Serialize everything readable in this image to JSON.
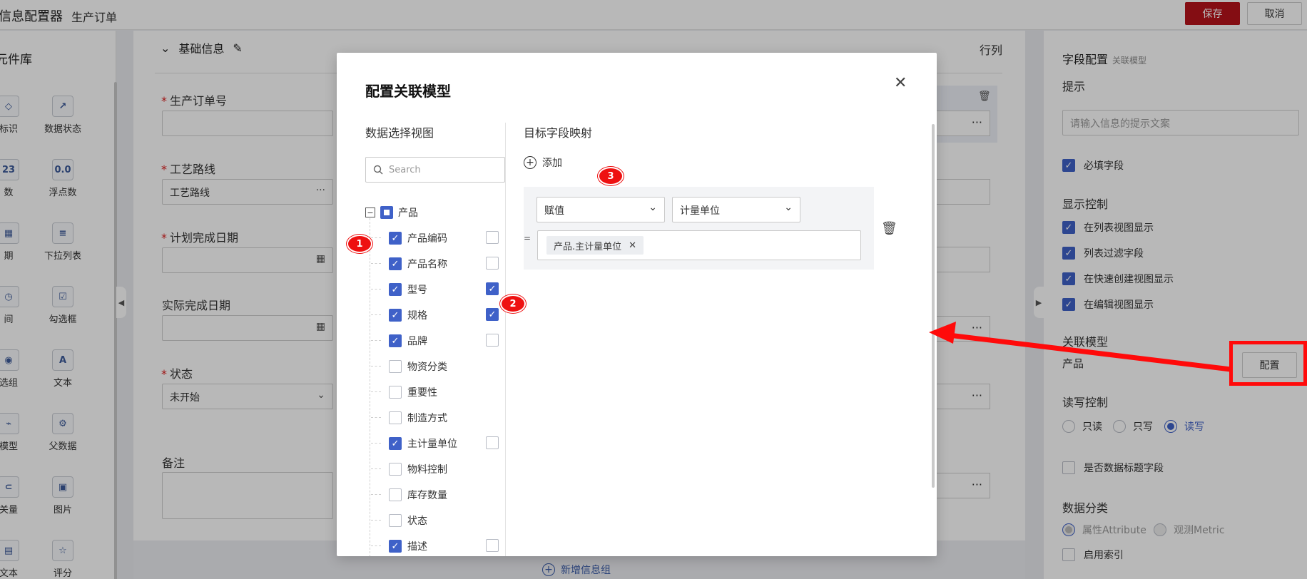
{
  "topbar": {
    "app_title": "信息配置器",
    "doc_title": "生产订单",
    "save_label": "保存",
    "cancel_label": "取消"
  },
  "left_panel": {
    "title": "元件库",
    "items": [
      {
        "label": "标识",
        "icon": "tag-icon"
      },
      {
        "label": "数据状态",
        "icon": "status-line-icon"
      },
      {
        "label": "数",
        "icon": "integer-icon"
      },
      {
        "label": "浮点数",
        "icon": "float-icon"
      },
      {
        "label": "期",
        "icon": "calendar-icon"
      },
      {
        "label": "下拉列表",
        "icon": "dropdown-list-icon"
      },
      {
        "label": "间",
        "icon": "clock-icon"
      },
      {
        "label": "勾选框",
        "icon": "checkbox-icon"
      },
      {
        "label": "选组",
        "icon": "radio-group-icon"
      },
      {
        "label": "文本",
        "icon": "text-icon"
      },
      {
        "label": "模型",
        "icon": "link-model-icon"
      },
      {
        "label": "父数据",
        "icon": "gear-icon"
      },
      {
        "label": "关量",
        "icon": "switch-icon"
      },
      {
        "label": "图片",
        "icon": "image-icon"
      },
      {
        "label": "文本",
        "icon": "long-text-icon"
      },
      {
        "label": "评分",
        "icon": "star-icon"
      }
    ],
    "icon_glyphs": [
      "◇",
      "↗",
      "23",
      "0.0",
      "▦",
      "≡",
      "◷",
      "☑",
      "◉",
      "A",
      "⌁",
      "⚙",
      "⊂",
      "▣",
      "▤",
      "☆"
    ]
  },
  "canvas": {
    "section_title": "基础信息",
    "row_col_label": "行列",
    "fields": [
      {
        "label": "生产订单号",
        "required": true,
        "value": ""
      },
      {
        "label": "工艺路线",
        "required": true,
        "value": "工艺路线"
      },
      {
        "label": "计划完成日期",
        "required": true,
        "value": ""
      },
      {
        "label": "实际完成日期",
        "required": false,
        "value": ""
      },
      {
        "label": "状态",
        "required": true,
        "value": "未开始"
      },
      {
        "label": "备注",
        "required": false,
        "value": ""
      }
    ],
    "add_group_label": "新增信息组"
  },
  "right_panel": {
    "title": "字段配置",
    "subtitle": "关联模型",
    "hint_label": "提示",
    "hint_placeholder": "请输入信息的提示文案",
    "required_label": "必填字段",
    "display_control_label": "显示控制",
    "display_options": [
      "在列表视图显示",
      "列表过滤字段",
      "在快速创建视图显示",
      "在编辑视图显示"
    ],
    "related_model_label": "关联模型",
    "related_model_value": "产品",
    "config_button": "配置",
    "rw_label": "读写控制",
    "rw_options": [
      "只读",
      "只写",
      "读写"
    ],
    "rw_selected": "读写",
    "title_field_label": "是否数据标题字段",
    "data_category_label": "数据分类",
    "data_category_options": [
      "属性Attribute",
      "观测Metric"
    ],
    "data_category_selected": "属性Attribute",
    "index_label": "启用索引"
  },
  "modal": {
    "title": "配置关联模型",
    "left_title": "数据选择视图",
    "search_placeholder": "Search",
    "root_label": "产品",
    "tree_items": [
      {
        "label": "产品编码",
        "checked": true,
        "side": "off"
      },
      {
        "label": "产品名称",
        "checked": true,
        "side": "off"
      },
      {
        "label": "型号",
        "checked": true,
        "side": "on"
      },
      {
        "label": "规格",
        "checked": true,
        "side": "on"
      },
      {
        "label": "品牌",
        "checked": true,
        "side": "off"
      },
      {
        "label": "物资分类",
        "checked": false,
        "side": "none"
      },
      {
        "label": "重要性",
        "checked": false,
        "side": "none"
      },
      {
        "label": "制造方式",
        "checked": false,
        "side": "none"
      },
      {
        "label": "主计量单位",
        "checked": true,
        "side": "off"
      },
      {
        "label": "物料控制",
        "checked": false,
        "side": "none"
      },
      {
        "label": "库存数量",
        "checked": false,
        "side": "none"
      },
      {
        "label": "状态",
        "checked": false,
        "side": "none"
      },
      {
        "label": "描述",
        "checked": true,
        "side": "off"
      }
    ],
    "right_title": "目标字段映射",
    "add_label": "添加",
    "mapping": {
      "action": "赋值",
      "target": "计量单位",
      "eq": "=",
      "value_tag": "产品.主计量单位"
    }
  },
  "annotations": [
    "1",
    "2",
    "3"
  ],
  "colors": {
    "accent": "#3f61c8",
    "save": "#b8131b",
    "annotation": "#ff0a0a"
  }
}
